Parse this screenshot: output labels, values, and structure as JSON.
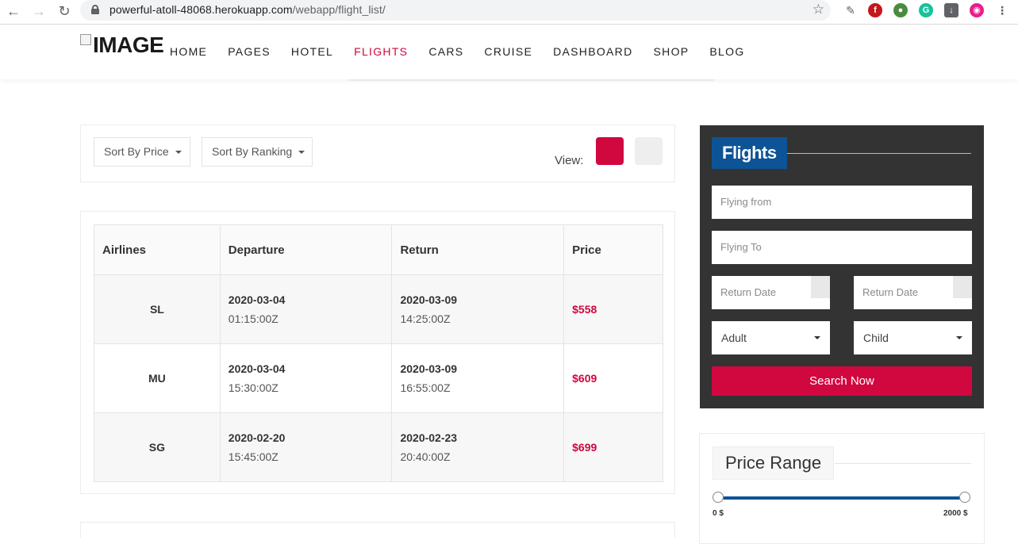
{
  "browser": {
    "url_host": "powerful-atoll-48068.herokuapp.com",
    "url_path": "/webapp/flight_list/"
  },
  "header": {
    "logo_text": "IMAGE",
    "menu": [
      {
        "label": "HOME"
      },
      {
        "label": "PAGES"
      },
      {
        "label": "HOTEL"
      },
      {
        "label": "FLIGHTS",
        "active": true
      },
      {
        "label": "CARS"
      },
      {
        "label": "CRUISE"
      },
      {
        "label": "DASHBOARD"
      },
      {
        "label": "SHOP"
      },
      {
        "label": "BLOG"
      }
    ]
  },
  "sort_bar": {
    "sort_price_label": "Sort By Price",
    "sort_ranking_label": "Sort By Ranking",
    "view_label": "View:"
  },
  "table": {
    "headers": [
      "Airlines",
      "Departure",
      "Return",
      "Price"
    ],
    "rows": [
      {
        "airline": "SL",
        "dep_date": "2020-03-04",
        "dep_time": "01:15:00Z",
        "ret_date": "2020-03-09",
        "ret_time": "14:25:00Z",
        "price": "$558"
      },
      {
        "airline": "MU",
        "dep_date": "2020-03-04",
        "dep_time": "15:30:00Z",
        "ret_date": "2020-03-09",
        "ret_time": "16:55:00Z",
        "price": "$609"
      },
      {
        "airline": "SG",
        "dep_date": "2020-02-20",
        "dep_time": "15:45:00Z",
        "ret_date": "2020-02-23",
        "ret_time": "20:40:00Z",
        "price": "$699"
      }
    ]
  },
  "flights_widget": {
    "title": "Flights",
    "from_placeholder": "Flying from",
    "to_placeholder": "Flying To",
    "date1_placeholder": "Return Date",
    "date2_placeholder": "Return Date",
    "adult_value": "Adult",
    "child_value": "Child",
    "search_label": "Search Now"
  },
  "price_range": {
    "title": "Price Range",
    "min_label": "0 $",
    "max_label": "2000 $"
  },
  "colors": {
    "accent": "#d1073f",
    "brand_blue": "#0d5497",
    "widget_bg": "#333333"
  }
}
